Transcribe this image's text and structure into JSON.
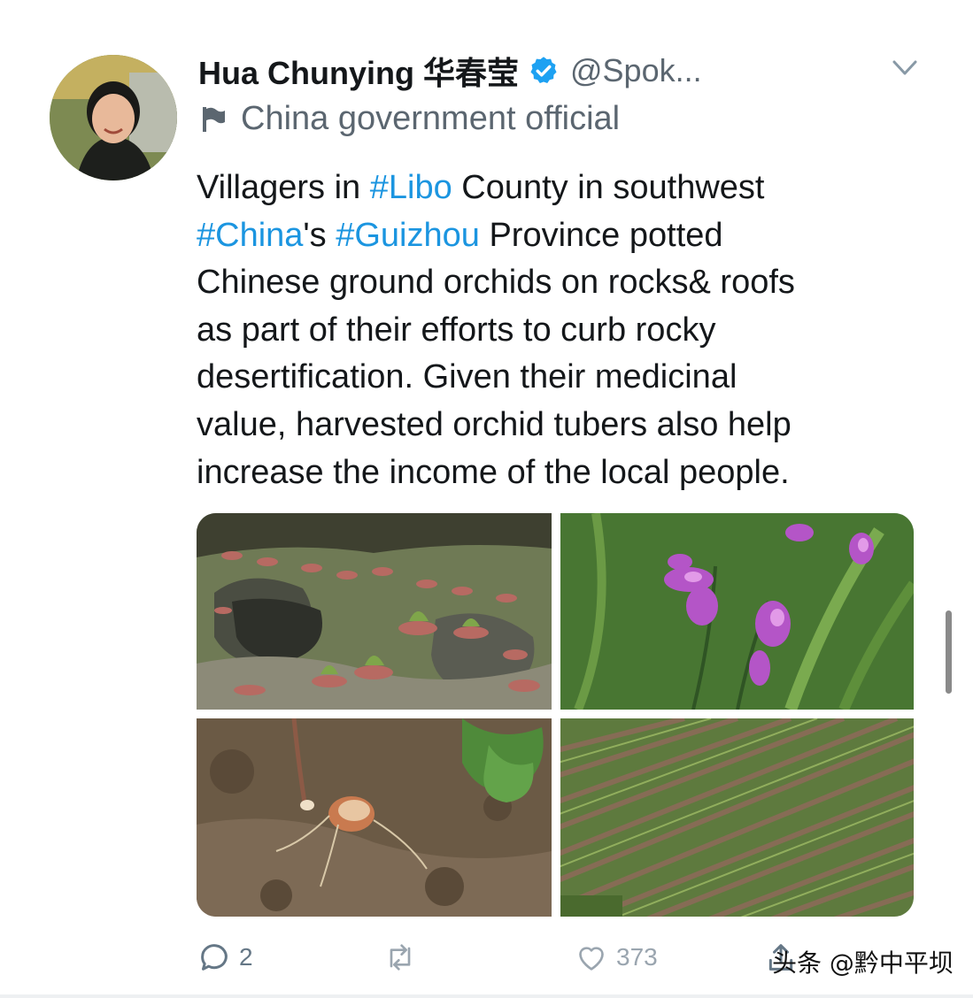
{
  "tweet": {
    "display_name": "Hua Chunying 华春莹",
    "handle": "@Spok...",
    "label": "China government official",
    "text_lines": [
      [
        {
          "t": "Villagers in ",
          "tag": false
        },
        {
          "t": "#Libo",
          "tag": true
        },
        {
          "t": " County in southwest",
          "tag": false
        }
      ],
      [
        {
          "t": "#China",
          "tag": true
        },
        {
          "t": "'s ",
          "tag": false
        },
        {
          "t": "#Guizhou",
          "tag": true
        },
        {
          "t": " Province potted",
          "tag": false
        }
      ],
      [
        {
          "t": "Chinese ground orchids on rocks& roofs",
          "tag": false
        }
      ],
      [
        {
          "t": "as part of their efforts to curb rocky",
          "tag": false
        }
      ],
      [
        {
          "t": "desertification. Given their medicinal",
          "tag": false
        }
      ],
      [
        {
          "t": "value, harvested orchid tubers also help",
          "tag": false
        }
      ],
      [
        {
          "t": "increase the income of the local people.",
          "tag": false
        }
      ]
    ]
  },
  "actions": {
    "reply_count": "2",
    "retweet_count": "",
    "like_count": "373"
  },
  "watermark": "头条 @黔中平坝",
  "colors": {
    "hashtag": "#1b95e0",
    "verified": "#1da1f2",
    "secondary_text": "#5b6670"
  },
  "icons": [
    "verified-badge-icon",
    "chevron-down-icon",
    "flag-icon",
    "reply-icon",
    "retweet-icon",
    "like-icon",
    "share-icon"
  ]
}
